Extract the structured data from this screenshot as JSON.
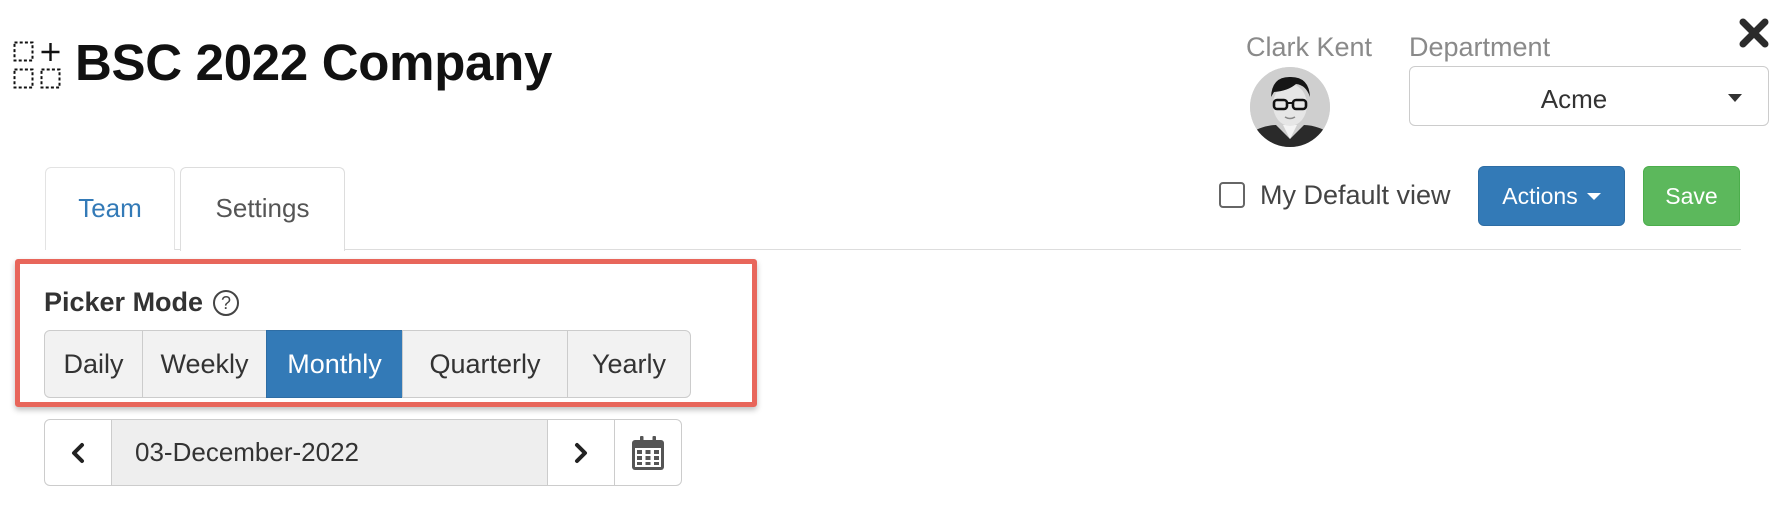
{
  "header": {
    "title": "BSC 2022 Company",
    "logo_icon": "dashed-grid-plus-icon",
    "close_icon": "close-icon"
  },
  "user": {
    "name": "Clark Kent"
  },
  "department": {
    "label": "Department",
    "selected": "Acme"
  },
  "tabs": [
    {
      "label": "Team",
      "active": false
    },
    {
      "label": "Settings",
      "active": true
    }
  ],
  "toolbar": {
    "default_view_label": "My Default view",
    "default_view_checked": false,
    "actions_label": "Actions",
    "save_label": "Save"
  },
  "picker": {
    "label": "Picker Mode",
    "help_glyph": "?",
    "modes": [
      "Daily",
      "Weekly",
      "Monthly",
      "Quarterly",
      "Yearly"
    ],
    "selected": "Monthly"
  },
  "date": {
    "value": "03-December-2022"
  },
  "colors": {
    "primary": "#337ab7",
    "success": "#5cb85c",
    "highlight": "#e8665b",
    "tab_link": "#337ab7"
  }
}
